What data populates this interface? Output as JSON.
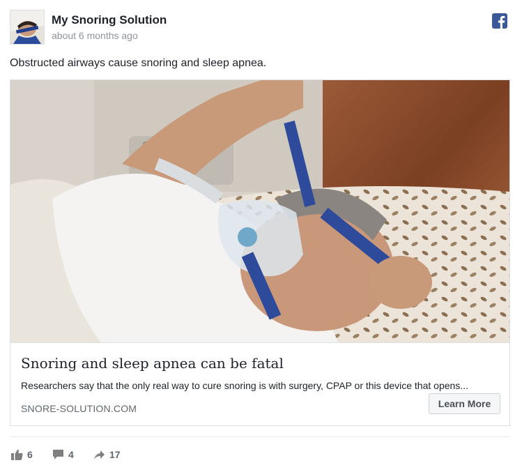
{
  "page": {
    "name": "My Snoring Solution",
    "timestamp": "about 6 months ago"
  },
  "post": {
    "text": "Obstructed airways cause snoring and sleep apnea."
  },
  "link": {
    "headline": "Snoring and sleep apnea can be fatal",
    "description": "Researchers say that the only real way to cure snoring is with surgery, CPAP or this device that opens...",
    "domain": "SNORE-SOLUTION.COM",
    "cta_label": "Learn More"
  },
  "engagement": {
    "likes": "6",
    "comments": "4",
    "shares": "17"
  },
  "colors": {
    "facebook_blue": "#3b5998",
    "text": "#1d2129",
    "meta_gray": "#90949c",
    "mask_strap": "#2e4a9a"
  },
  "icons": {
    "platform": "facebook-icon",
    "likes": "thumbs-up-icon",
    "comments": "comment-icon",
    "shares": "share-arrow-icon"
  }
}
